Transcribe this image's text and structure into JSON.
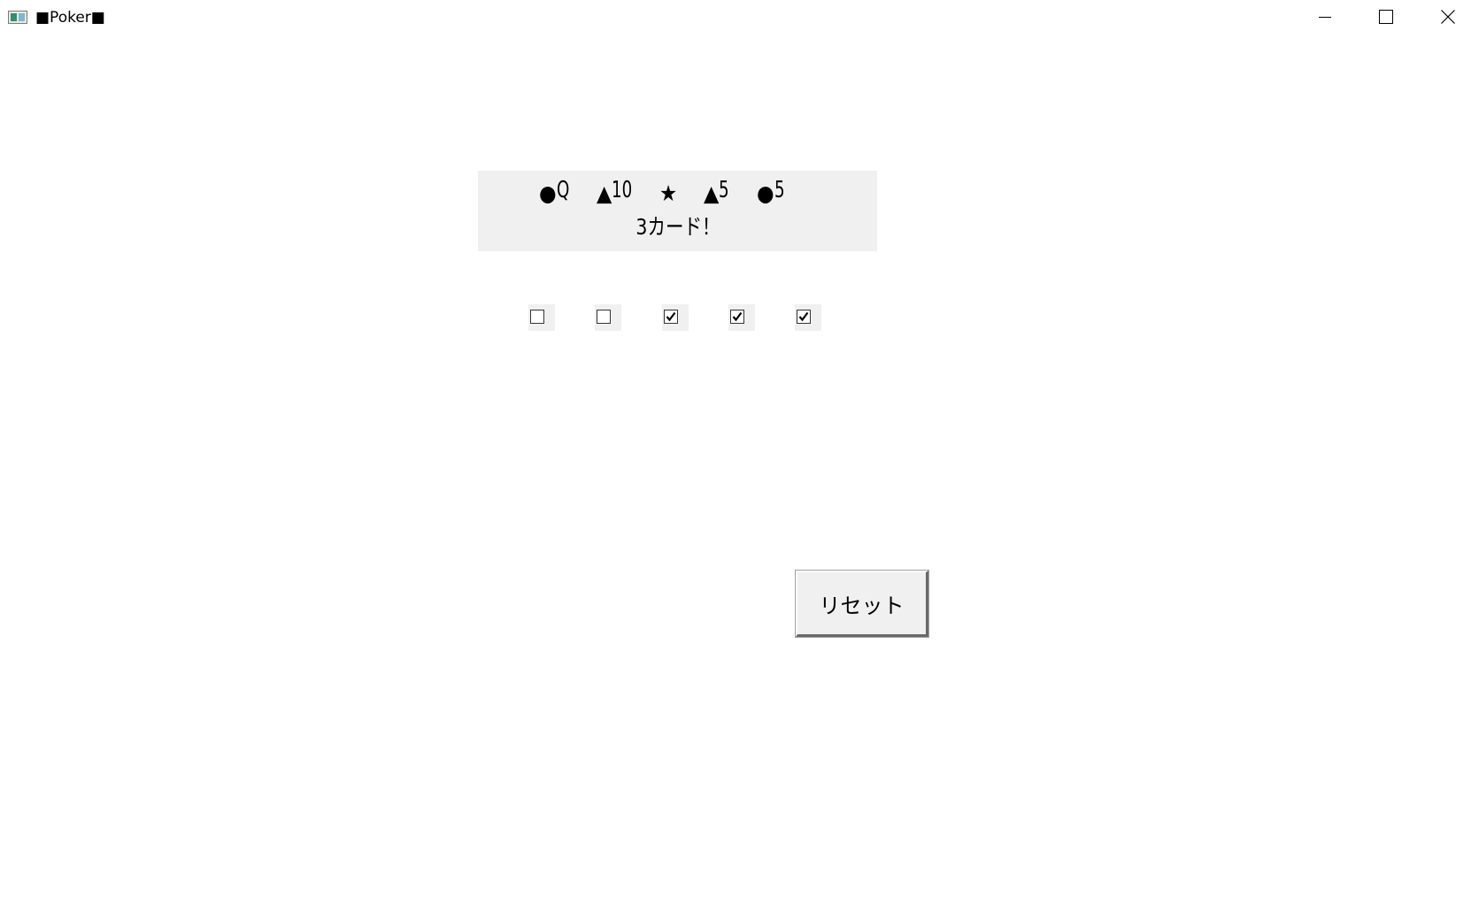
{
  "window": {
    "title": "■Poker■",
    "controls": {
      "minimize": "minimize-icon",
      "maximize": "maximize-icon",
      "close": "close-icon"
    }
  },
  "hand": {
    "cards": [
      {
        "suit": "●",
        "rank": "Q"
      },
      {
        "suit": "▲",
        "rank": "10"
      },
      {
        "suit": "★",
        "rank": ""
      },
      {
        "suit": "▲",
        "rank": "5"
      },
      {
        "suit": "●",
        "rank": "5"
      }
    ],
    "result_label": "3カード！"
  },
  "hold": [
    {
      "checked": false
    },
    {
      "checked": false
    },
    {
      "checked": true
    },
    {
      "checked": true
    },
    {
      "checked": true
    }
  ],
  "actions": {
    "reset_label": "リセット"
  },
  "colors": {
    "panel_background": "#f0f0f0",
    "window_background": "#ffffff"
  }
}
